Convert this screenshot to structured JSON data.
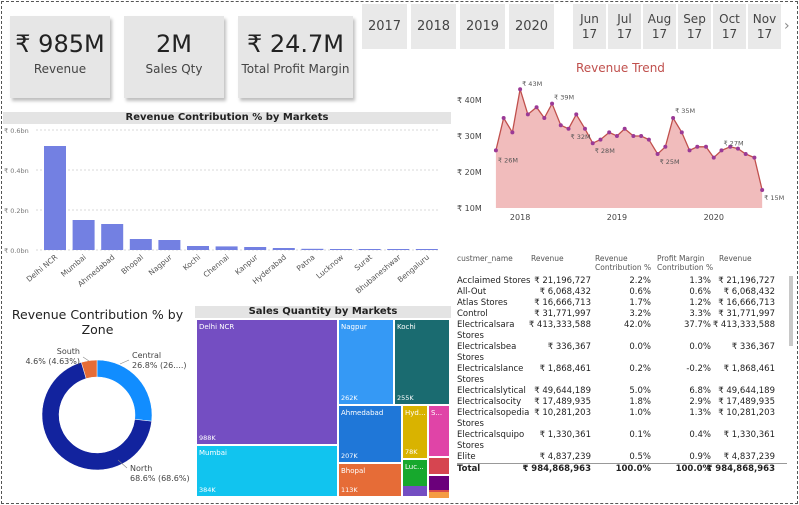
{
  "kpis": [
    {
      "value": "₹ 985M",
      "label": "Revenue"
    },
    {
      "value": "2M",
      "label": "Sales Qty"
    },
    {
      "value": "₹ 24.7M",
      "label": "Total Profit Margin"
    }
  ],
  "years": [
    "2017",
    "2018",
    "2019",
    "2020"
  ],
  "months": [
    {
      "m": "Jun",
      "y": "17"
    },
    {
      "m": "Jul",
      "y": "17"
    },
    {
      "m": "Aug",
      "y": "17"
    },
    {
      "m": "Sep",
      "y": "17"
    },
    {
      "m": "Oct",
      "y": "17"
    },
    {
      "m": "Nov",
      "y": "17"
    }
  ],
  "colors": {
    "bar": "#7380e2",
    "trend_line": "#9b3a96",
    "trend_fill": "#efb0b0",
    "accent_red": "#c0504d"
  },
  "chart_data": [
    {
      "type": "bar",
      "title": "Revenue Contribution % by Markets",
      "categories": [
        "Delhi NCR",
        "Mumbai",
        "Ahmedabad",
        "Bhopal",
        "Nagpur",
        "Kochi",
        "Chennai",
        "Kanpur",
        "Hyderabad",
        "Patna",
        "Lucknow",
        "Surat",
        "Bhubaneshwar",
        "Bengaluru"
      ],
      "values": [
        0.52,
        0.15,
        0.13,
        0.055,
        0.05,
        0.02,
        0.018,
        0.015,
        0.01,
        0.006,
        0.004,
        0.003,
        0.002,
        0.001
      ],
      "yticks": [
        "₹ 0.6bn",
        "₹ 0.4bn",
        "₹ 0.2bn",
        "₹ 0.0bn"
      ],
      "ylim": [
        0,
        0.6
      ]
    },
    {
      "type": "area",
      "title": "Revenue Trend",
      "x": [
        2017.75,
        2017.83,
        2017.92,
        2018.0,
        2018.08,
        2018.17,
        2018.25,
        2018.33,
        2018.42,
        2018.5,
        2018.58,
        2018.67,
        2018.75,
        2018.83,
        2018.92,
        2019.0,
        2019.08,
        2019.17,
        2019.25,
        2019.33,
        2019.42,
        2019.5,
        2019.58,
        2019.67,
        2019.75,
        2019.83,
        2019.92,
        2020.0,
        2020.08,
        2020.17,
        2020.25,
        2020.33,
        2020.42,
        2020.5
      ],
      "values": [
        26,
        35,
        31,
        43,
        36,
        38,
        35,
        39,
        33,
        32,
        36,
        32,
        28,
        29,
        31,
        30,
        32,
        30,
        30,
        29,
        25,
        27,
        35,
        31,
        26,
        27,
        27,
        24,
        26,
        27,
        26.5,
        25,
        24,
        15
      ],
      "annotations": [
        "₹ 26M",
        "₹ 43M",
        "₹ 39M",
        "₹ 32M",
        "₹ 28M",
        "₹ 25M",
        "₹ 35M",
        "₹ 27M",
        "₹ 15M"
      ],
      "yticks": [
        "₹ 40M",
        "₹ 30M",
        "₹ 20M",
        "₹ 10M"
      ],
      "xticks": [
        "2018",
        "2019",
        "2020"
      ],
      "ylim": [
        10,
        40
      ]
    },
    {
      "type": "pie",
      "title": "Revenue Contribution % by Zone",
      "slices": [
        {
          "name": "North",
          "value": 68.6,
          "label": "North",
          "sub": "68.6% (68.6%)",
          "color": "#12239e"
        },
        {
          "name": "Central",
          "value": 26.8,
          "label": "Central",
          "sub": "26.8% (26....)",
          "color": "#118dff"
        },
        {
          "name": "South",
          "value": 4.6,
          "label": "South",
          "sub": "4.6% (4.63%)",
          "color": "#e66c37"
        }
      ]
    }
  ],
  "treemap": {
    "title": "Sales Quantity by Markets",
    "tiles": [
      {
        "name": "Delhi NCR",
        "value": "988K",
        "color": "#744ec2"
      },
      {
        "name": "Mumbai",
        "value": "384K",
        "color": "#11c4ef"
      },
      {
        "name": "Nagpur",
        "value": "262K",
        "color": "#3599f5"
      },
      {
        "name": "Kochi",
        "value": "255K",
        "color": "#1a6b70"
      },
      {
        "name": "Ahmedabad",
        "value": "207K",
        "color": "#1f77d8"
      },
      {
        "name": "Bhopal",
        "value": "113K",
        "color": "#e66c37"
      },
      {
        "name": "Hyd...",
        "value": "78K",
        "color": "#d9b300"
      },
      {
        "name": "S...",
        "value": "",
        "color": "#e044a7"
      },
      {
        "name": "Luc...",
        "value": "",
        "color": "#17a82d"
      },
      {
        "name": "",
        "value": "",
        "color": "#d64550"
      },
      {
        "name": "",
        "value": "",
        "color": "#6b007b"
      },
      {
        "name": "",
        "value": "",
        "color": "#d94a4a"
      },
      {
        "name": "",
        "value": "",
        "color": "#744ec2"
      },
      {
        "name": "",
        "value": "",
        "color": "#b887e6"
      },
      {
        "name": "",
        "value": "",
        "color": "#f59c42"
      }
    ]
  },
  "table": {
    "headers": [
      "custmer_name",
      "Revenue",
      "Revenue Contribution %",
      "Profit Margin Contribution %",
      "Revenue"
    ],
    "rows": [
      {
        "name": "Acclaimed Stores",
        "name2": "",
        "rev": "₹ 21,196,727",
        "rc": "2.2%",
        "pm": "1.3%",
        "rev2": "₹ 21,196,727"
      },
      {
        "name": "All-Out",
        "name2": "",
        "rev": "₹ 6,068,432",
        "rc": "0.6%",
        "pm": "0.6%",
        "rev2": "₹ 6,068,432"
      },
      {
        "name": "Atlas Stores",
        "name2": "",
        "rev": "₹ 16,666,713",
        "rc": "1.7%",
        "pm": "1.2%",
        "rev2": "₹ 16,666,713"
      },
      {
        "name": "Control",
        "name2": "",
        "rev": "₹ 31,771,997",
        "rc": "3.2%",
        "pm": "3.3%",
        "rev2": "₹ 31,771,997"
      },
      {
        "name": "Electricalsara",
        "name2": "Stores",
        "rev": "₹ 413,333,588",
        "rc": "42.0%",
        "pm": "37.7%",
        "rev2": "₹ 413,333,588"
      },
      {
        "name": "Electricalsbea",
        "name2": "Stores",
        "rev": "₹ 336,367",
        "rc": "0.0%",
        "pm": "0.0%",
        "rev2": "₹ 336,367"
      },
      {
        "name": "Electricalslance",
        "name2": "Stores",
        "rev": "₹ 1,868,461",
        "rc": "0.2%",
        "pm": "-0.2%",
        "rev2": "₹ 1,868,461"
      },
      {
        "name": "Electricalslytical",
        "name2": "",
        "rev": "₹ 49,644,189",
        "rc": "5.0%",
        "pm": "6.8%",
        "rev2": "₹ 49,644,189"
      },
      {
        "name": "Electricalsocity",
        "name2": "",
        "rev": "₹ 17,489,935",
        "rc": "1.8%",
        "pm": "2.9%",
        "rev2": "₹ 17,489,935"
      },
      {
        "name": "Electricalsopedia",
        "name2": "Stores",
        "rev": "₹ 10,281,203",
        "rc": "1.0%",
        "pm": "1.3%",
        "rev2": "₹ 10,281,203"
      },
      {
        "name": "Electricalsquipo",
        "name2": "Stores",
        "rev": "₹ 1,330,361",
        "rc": "0.1%",
        "pm": "0.4%",
        "rev2": "₹ 1,330,361"
      },
      {
        "name": "Elite",
        "name2": "",
        "rev": "₹ 4,837,239",
        "rc": "0.5%",
        "pm": "0.9%",
        "rev2": "₹ 4,837,239"
      }
    ],
    "total": {
      "name": "Total",
      "rev": "₹ 984,868,963",
      "rc": "100.0%",
      "pm": "100.0%",
      "rev2": "₹ 984,868,963"
    }
  }
}
